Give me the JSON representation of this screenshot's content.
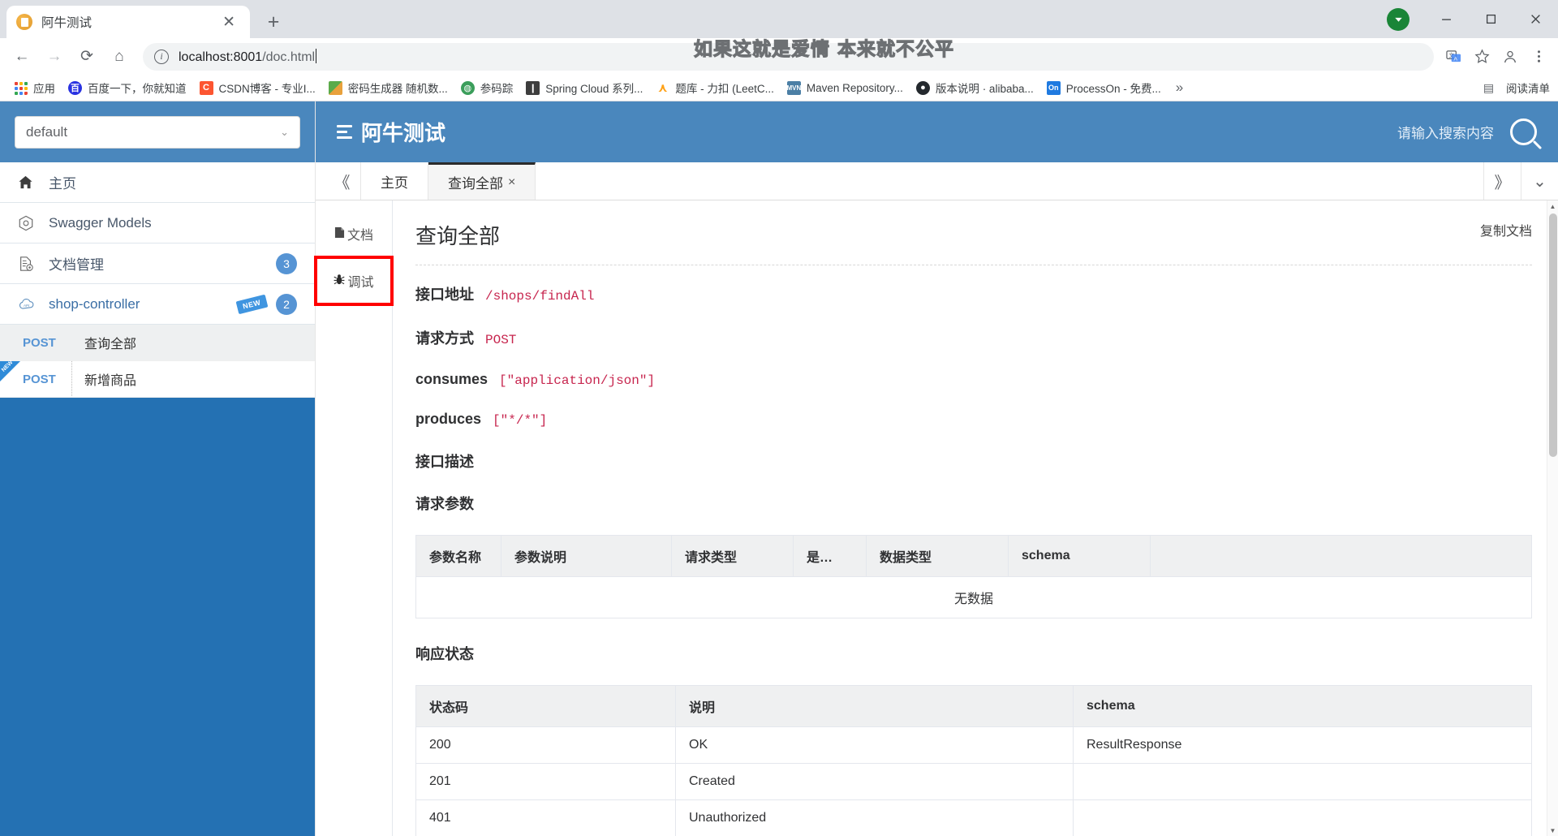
{
  "browser": {
    "tab": {
      "title": "阿牛测试",
      "favicon": "document-icon",
      "close": "✕"
    },
    "new_tab_label": "+",
    "window_controls": {
      "minimize": "—",
      "maximize": "▢",
      "close": "✕"
    },
    "nav": {
      "back": "←",
      "forward": "→",
      "reload": "⟳",
      "home": "⌂"
    },
    "omnibox": {
      "info_icon": "i",
      "url_host": "localhost:8001",
      "url_path": "/doc.html"
    },
    "toolbar_icons": [
      "translate-icon",
      "bookmark-star-icon",
      "profile-icon",
      "menu-kebab-icon"
    ],
    "bookmarks": [
      {
        "label": "应用",
        "icon": "apps-grid-icon",
        "color": "#ffffff"
      },
      {
        "label": "百度一下，你就知道",
        "icon": "baidu-icon",
        "color": "#2932e1"
      },
      {
        "label": "CSDN博客 - 专业I...",
        "icon": "csdn-icon",
        "color": "#fc5531"
      },
      {
        "label": "密码生成器 随机数...",
        "icon": "password-icon",
        "color": "#5bab4a"
      },
      {
        "label": "参码踪",
        "icon": "globe-icon",
        "color": "#3b9e5b"
      },
      {
        "label": "Spring Cloud 系列...",
        "icon": "spring-icon",
        "color": "#6db33f"
      },
      {
        "label": "题库 - 力扣 (LeetC...",
        "icon": "leetcode-icon",
        "color": "#ffa116"
      },
      {
        "label": "Maven Repository...",
        "icon": "maven-icon",
        "color": "#4b7fa5"
      },
      {
        "label": "版本说明 · alibaba...",
        "icon": "github-icon",
        "color": "#24292e"
      },
      {
        "label": "ProcessOn - 免费...",
        "icon": "processon-icon",
        "color": "#1f7ae0"
      }
    ],
    "bookmarks_overflow": "»",
    "reading_list": {
      "label": "阅读清单",
      "icon": "reading-list-icon"
    },
    "watermark": "如果这就是爱情 本来就不公平"
  },
  "sidebar": {
    "select": {
      "value": "default",
      "caret": "⌄"
    },
    "menu": [
      {
        "label": "主页",
        "icon": "home-icon",
        "badge": null,
        "new": false,
        "kind": "plain"
      },
      {
        "label": "Swagger Models",
        "icon": "swagger-icon",
        "badge": null,
        "new": false,
        "kind": "plain"
      },
      {
        "label": "文档管理",
        "icon": "doc-settings-icon",
        "badge": "3",
        "new": false,
        "kind": "plain"
      },
      {
        "label": "shop-controller",
        "icon": "api-cloud-icon",
        "badge": "2",
        "new": true,
        "kind": "link"
      }
    ],
    "apis": [
      {
        "verb": "POST",
        "name": "查询全部",
        "selected": true,
        "new": false
      },
      {
        "verb": "POST",
        "name": "新增商品",
        "selected": false,
        "new": true,
        "new_text": "NEW"
      }
    ]
  },
  "header": {
    "title": "阿牛测试",
    "search_placeholder": "请输入搜索内容",
    "search_icon": "search-icon",
    "menu_icon": "hamburger-icon"
  },
  "tabbar": {
    "collapse_left": "《",
    "tabs": [
      {
        "label": "主页",
        "active": false,
        "closable": false
      },
      {
        "label": "查询全部",
        "active": true,
        "closable": true,
        "close": "×"
      }
    ],
    "expand_right": "》",
    "dropdown": "⌄"
  },
  "vtabs": [
    {
      "label": "文档",
      "icon": "document-page-icon",
      "active": true,
      "highlighted": false
    },
    {
      "label": "调试",
      "icon": "bug-icon",
      "active": false,
      "highlighted": true
    }
  ],
  "doc": {
    "title": "查询全部",
    "copy_label": "复制文档",
    "fields": [
      {
        "key": "接口地址",
        "value": "/shops/findAll"
      },
      {
        "key": "请求方式",
        "value": "POST"
      },
      {
        "key": "consumes",
        "value": "[\"application/json\"]"
      },
      {
        "key": "produces",
        "value": "[\"*/*\"]"
      }
    ],
    "description_title": "接口描述",
    "description_value": "",
    "params_title": "请求参数",
    "params_columns": [
      "参数名称",
      "参数说明",
      "请求类型",
      "是…",
      "数据类型",
      "schema"
    ],
    "params_empty_text": "无数据",
    "status_title": "响应状态",
    "status_columns": [
      "状态码",
      "说明",
      "schema"
    ],
    "status_rows": [
      {
        "code": "200",
        "desc": "OK",
        "schema": "ResultResponse"
      },
      {
        "code": "201",
        "desc": "Created",
        "schema": ""
      },
      {
        "code": "401",
        "desc": "Unauthorized",
        "schema": ""
      }
    ]
  },
  "colors": {
    "brand_blue": "#4a87bd",
    "sidebar_fill": "#2471b3",
    "highlight_red": "#ff0000",
    "code_red": "#c7254e",
    "link_blue": "#3a6ea5"
  }
}
